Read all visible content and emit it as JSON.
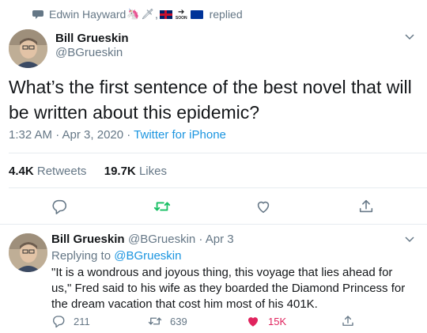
{
  "context": {
    "user": "Edwin Hayward",
    "comma": ",",
    "action": "replied",
    "soon_label": "SOON"
  },
  "tweet": {
    "name": "Bill Grueskin",
    "handle": "@BGrueskin",
    "text": "What’s the first sentence of the best novel that will be written about this epidemic?",
    "time": "1:32 AM · Apr 3, 2020 · ",
    "source": "Twitter for iPhone",
    "retweets_count": "4.4K",
    "retweets_label": "Retweets",
    "likes_count": "19.7K",
    "likes_label": "Likes"
  },
  "reply": {
    "name": "Bill Grueskin",
    "handle_date": "@BGrueskin · Apr 3",
    "replying_prefix": "Replying to ",
    "replying_handle": "@BGrueskin",
    "text": "\"It is a wondrous and joyous thing, this voyage that lies ahead for us,\" Fred said to his wife as they boarded the Diamond Princess for the dream vacation that cost him most of his 401K.",
    "reply_count": "211",
    "retweet_count": "639",
    "like_count": "15K"
  },
  "colors": {
    "accent": "#1b95e0",
    "retweet": "#17bf63",
    "like": "#e0245e",
    "muted": "#657786"
  },
  "icons": [
    "speech-bubble-icon",
    "unicorn-emoji",
    "sword-emoji",
    "uk-flag",
    "soon-arrow-emoji",
    "eu-flag",
    "chevron-down-icon",
    "reply-icon",
    "retweet-icon",
    "heart-icon",
    "share-icon"
  ]
}
